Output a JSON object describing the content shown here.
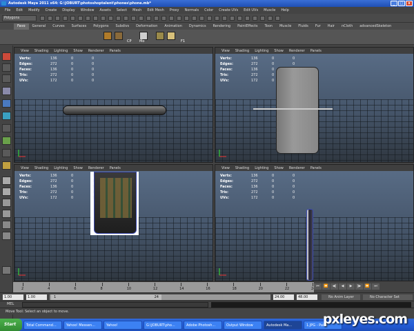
{
  "window": {
    "title": "Autodesk Maya 2011 x64: G:\\JOBURT\\photoshoptalent\\phones\\phone.mb*",
    "minimize": "_",
    "maximize": "□",
    "close": "x"
  },
  "menus": [
    "File",
    "Edit",
    "Modify",
    "Create",
    "Display",
    "Window",
    "Assets",
    "Select",
    "Mesh",
    "Edit Mesh",
    "Proxy",
    "Normals",
    "Color",
    "Create UVs",
    "Edit UVs",
    "Muscle",
    "Help"
  ],
  "mode_selector": "Polygons",
  "shelf_tabs": [
    "Favo",
    "General",
    "Curves",
    "Surfaces",
    "Polygons",
    "Subdivs",
    "Deformation",
    "Animation",
    "Dynamics",
    "Rendering",
    "PaintEffects",
    "Toon",
    "Muscle",
    "Fluids",
    "Fur",
    "Hair",
    "nCloth",
    "advancedSkeleton"
  ],
  "shelf_active_tab": "Favo",
  "shelf_labels": [
    "CP",
    "Mo",
    "F1"
  ],
  "panel_menu": [
    "View",
    "Shading",
    "Lighting",
    "Show",
    "Renderer",
    "Panels"
  ],
  "hud": {
    "rows": [
      {
        "label": "Verts:",
        "a": "136",
        "b": "0",
        "c": "0"
      },
      {
        "label": "Edges:",
        "a": "272",
        "b": "0",
        "c": "0"
      },
      {
        "label": "Faces:",
        "a": "136",
        "b": "0",
        "c": "0"
      },
      {
        "label": "Tris:",
        "a": "272",
        "b": "0",
        "c": "0"
      },
      {
        "label": "UVs:",
        "a": "172",
        "b": "0",
        "c": "0"
      }
    ]
  },
  "timeline": {
    "ticks": [
      "2",
      "4",
      "6",
      "8",
      "10",
      "12",
      "14",
      "16",
      "18",
      "20",
      "22",
      "24"
    ],
    "current": "1"
  },
  "range": {
    "start": "1.00",
    "inner_start": "1.00",
    "range_current": "1",
    "range_end": "24",
    "end": "24.00",
    "anim_end": "48.00",
    "anim_layer": "No Anim Layer",
    "char_set": "No Character Set"
  },
  "command_line": {
    "label": "MEL"
  },
  "help_line": "Move Tool: Select an object to move.",
  "taskbar": {
    "start": "Start",
    "tasks": [
      "Total Command...",
      "Yahoo! Messen...",
      "Yahoo!",
      "G:\\JOBURT\\pho...",
      "Adobe Photosh...",
      "Output Window",
      "Autodesk Ma...",
      "1.JPG - Paint"
    ],
    "active_index": 6
  },
  "watermark": "pxleyes.com"
}
